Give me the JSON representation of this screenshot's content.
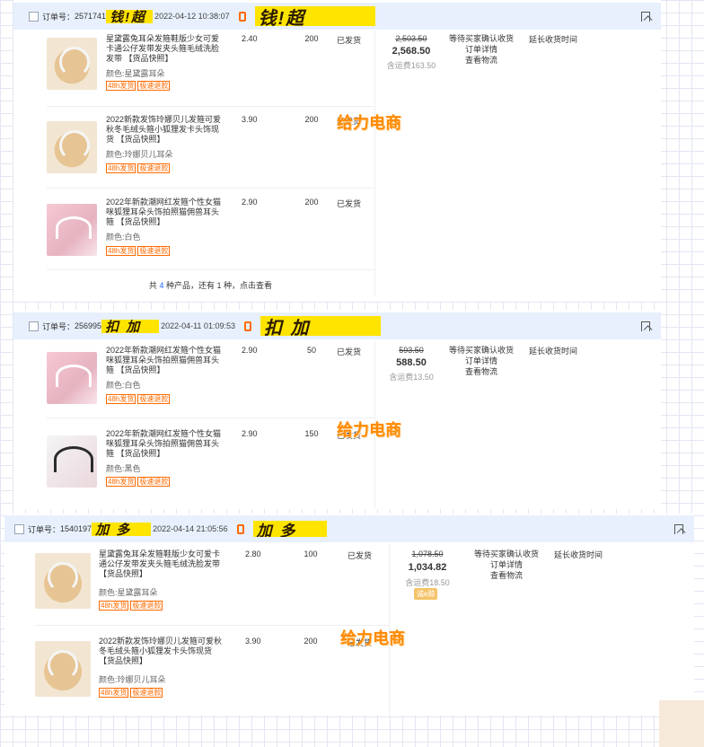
{
  "common": {
    "order_label": "订单号：",
    "tag_48h": "48h发货",
    "tag_refund": "极速退款",
    "item_status": "已发货",
    "status_await": "等待买家确认收货",
    "link_detail": "订单详情",
    "link_logistics": "查看物流",
    "extend_receipt": "延长收货时间",
    "watermark": "给力电商",
    "more_prefix": "共",
    "more_mid": "种产品，还有",
    "more_suffix": "种，点击查看"
  },
  "orders": [
    {
      "order_no": "2571741",
      "redact_text": "钱!超",
      "time": "2022-04-12 10:38:07",
      "old_total": "2,503.50",
      "total": "2,568.50",
      "shipping": "含运费163.50",
      "more_count": "4",
      "more_rest": "1",
      "items": [
        {
          "title": "星黛露兔耳朵发箍鞋版少女可爱卡通公仔发带发夹头箍毛绒洗脸发带 【货品快照】",
          "attr": "颜色:星黛露耳朵",
          "price": "2.40",
          "qty": "200"
        },
        {
          "title": "2022新款发饰玲娜贝儿发箍可爱秋冬毛绒头箍小狐狸发卡头饰现货 【货品快照】",
          "attr": "颜色:玲娜贝儿耳朵",
          "price": "3.90",
          "qty": "200"
        },
        {
          "title": "2022年新款潮网红发箍个性女猫咪狐狸耳朵头饰拍照猫佣兽耳头箍 【货品快照】",
          "attr": "颜色:白色",
          "price": "2.90",
          "qty": "200"
        }
      ]
    },
    {
      "order_no": "256995",
      "redact_text": "扣 加",
      "time": "2022-04-11 01:09:53",
      "old_total": "593.50",
      "total": "588.50",
      "shipping": "含运费13.50",
      "items": [
        {
          "title": "2022年新款潮网红发箍个性女猫咪狐狸耳朵头饰拍照猫佣兽耳头箍 【货品快照】",
          "attr": "颜色:白色",
          "price": "2.90",
          "qty": "50"
        },
        {
          "title": "2022年新款潮网红发箍个性女猫咪狐狸耳朵头饰拍照猫佣兽耳头箍 【货品快照】",
          "attr": "颜色:黑色",
          "price": "2.90",
          "qty": "150"
        }
      ]
    },
    {
      "order_no": "1540197",
      "redact_text": "加 多",
      "time": "2022-04-14 21:05:56",
      "old_total": "1,078.50",
      "total": "1,034.82",
      "shipping": "含运费18.50",
      "badge": "诚e赊",
      "items": [
        {
          "title": "星黛露兔耳朵发箍鞋版少女可爱卡通公仔发带发夹头箍毛绒洗脸发带 【货品快照】",
          "attr": "颜色:星黛露耳朵",
          "price": "2.80",
          "qty": "100"
        },
        {
          "title": "2022新款发饰玲娜贝儿发箍可爱秋冬毛绒头箍小狐狸发卡头饰现货 【货品快照】",
          "attr": "颜色:玲娜贝儿耳朵",
          "price": "3.90",
          "qty": "200"
        }
      ]
    }
  ]
}
